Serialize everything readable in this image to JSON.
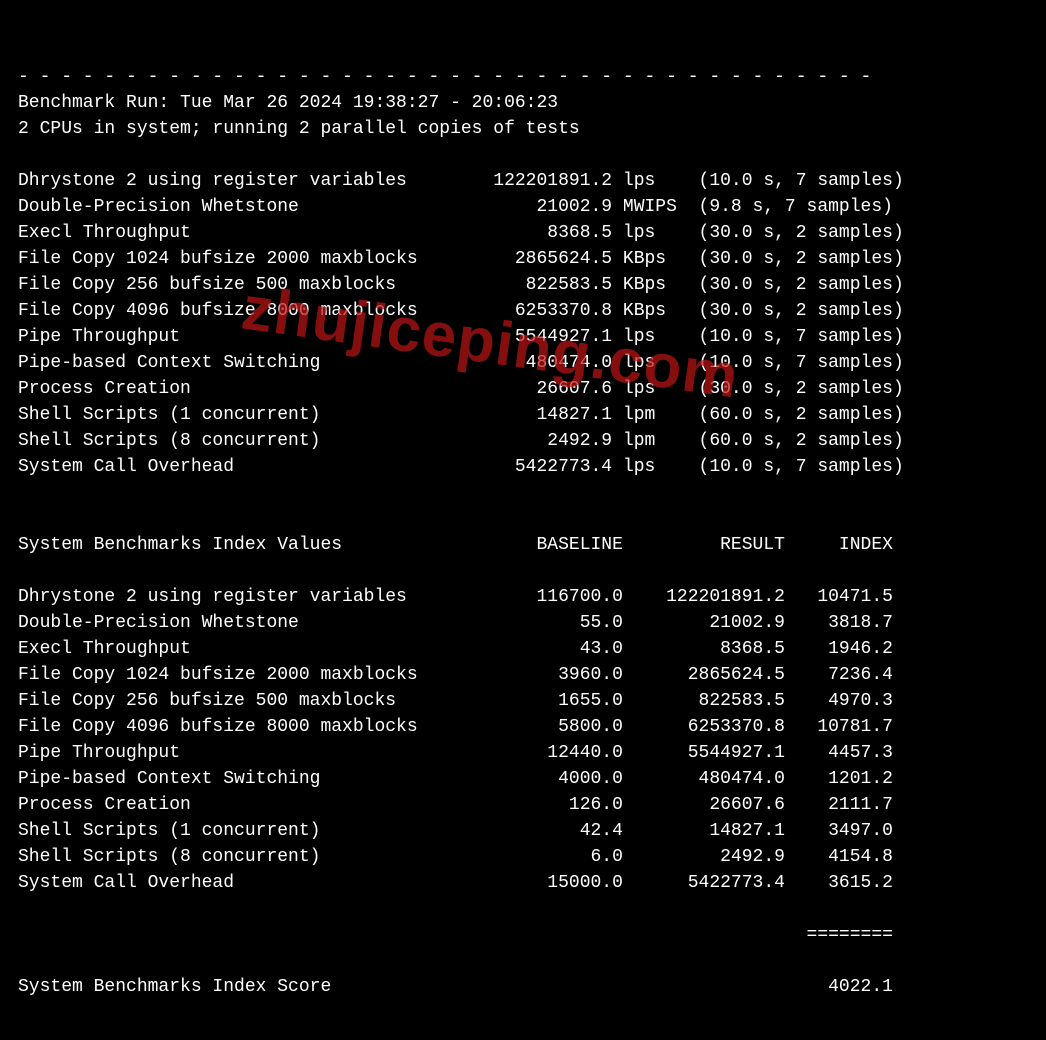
{
  "separator": "- - - - - - - - - - - - - - - - - - - - - - - - - - - - - - - - - - - - - - - -",
  "header": {
    "run_line": "Benchmark Run: Tue Mar 26 2024 19:38:27 - 20:06:23",
    "cpu_line": "2 CPUs in system; running 2 parallel copies of tests"
  },
  "results": [
    {
      "name": "Dhrystone 2 using register variables",
      "value": "122201891.2",
      "unit": "lps",
      "timing": "(10.0 s, 7 samples)"
    },
    {
      "name": "Double-Precision Whetstone",
      "value": "21002.9",
      "unit": "MWIPS",
      "timing": "(9.8 s, 7 samples)"
    },
    {
      "name": "Execl Throughput",
      "value": "8368.5",
      "unit": "lps",
      "timing": "(30.0 s, 2 samples)"
    },
    {
      "name": "File Copy 1024 bufsize 2000 maxblocks",
      "value": "2865624.5",
      "unit": "KBps",
      "timing": "(30.0 s, 2 samples)"
    },
    {
      "name": "File Copy 256 bufsize 500 maxblocks",
      "value": "822583.5",
      "unit": "KBps",
      "timing": "(30.0 s, 2 samples)"
    },
    {
      "name": "File Copy 4096 bufsize 8000 maxblocks",
      "value": "6253370.8",
      "unit": "KBps",
      "timing": "(30.0 s, 2 samples)"
    },
    {
      "name": "Pipe Throughput",
      "value": "5544927.1",
      "unit": "lps",
      "timing": "(10.0 s, 7 samples)"
    },
    {
      "name": "Pipe-based Context Switching",
      "value": "480474.0",
      "unit": "lps",
      "timing": "(10.0 s, 7 samples)"
    },
    {
      "name": "Process Creation",
      "value": "26607.6",
      "unit": "lps",
      "timing": "(30.0 s, 2 samples)"
    },
    {
      "name": "Shell Scripts (1 concurrent)",
      "value": "14827.1",
      "unit": "lpm",
      "timing": "(60.0 s, 2 samples)"
    },
    {
      "name": "Shell Scripts (8 concurrent)",
      "value": "2492.9",
      "unit": "lpm",
      "timing": "(60.0 s, 2 samples)"
    },
    {
      "name": "System Call Overhead",
      "value": "5422773.4",
      "unit": "lps",
      "timing": "(10.0 s, 7 samples)"
    }
  ],
  "index_header": {
    "title": "System Benchmarks Index Values",
    "col_baseline": "BASELINE",
    "col_result": "RESULT",
    "col_index": "INDEX"
  },
  "index_rows": [
    {
      "name": "Dhrystone 2 using register variables",
      "baseline": "116700.0",
      "result": "122201891.2",
      "index": "10471.5"
    },
    {
      "name": "Double-Precision Whetstone",
      "baseline": "55.0",
      "result": "21002.9",
      "index": "3818.7"
    },
    {
      "name": "Execl Throughput",
      "baseline": "43.0",
      "result": "8368.5",
      "index": "1946.2"
    },
    {
      "name": "File Copy 1024 bufsize 2000 maxblocks",
      "baseline": "3960.0",
      "result": "2865624.5",
      "index": "7236.4"
    },
    {
      "name": "File Copy 256 bufsize 500 maxblocks",
      "baseline": "1655.0",
      "result": "822583.5",
      "index": "4970.3"
    },
    {
      "name": "File Copy 4096 bufsize 8000 maxblocks",
      "baseline": "5800.0",
      "result": "6253370.8",
      "index": "10781.7"
    },
    {
      "name": "Pipe Throughput",
      "baseline": "12440.0",
      "result": "5544927.1",
      "index": "4457.3"
    },
    {
      "name": "Pipe-based Context Switching",
      "baseline": "4000.0",
      "result": "480474.0",
      "index": "1201.2"
    },
    {
      "name": "Process Creation",
      "baseline": "126.0",
      "result": "26607.6",
      "index": "2111.7"
    },
    {
      "name": "Shell Scripts (1 concurrent)",
      "baseline": "42.4",
      "result": "14827.1",
      "index": "3497.0"
    },
    {
      "name": "Shell Scripts (8 concurrent)",
      "baseline": "6.0",
      "result": "2492.9",
      "index": "4154.8"
    },
    {
      "name": "System Call Overhead",
      "baseline": "15000.0",
      "result": "5422773.4",
      "index": "3615.2"
    }
  ],
  "score": {
    "rule": "========",
    "label": "System Benchmarks Index Score",
    "value": "4022.1"
  },
  "watermark": "zhujiceping.com",
  "col": {
    "name_w": 41,
    "value_w": 14,
    "unit_w": 6,
    "idx_name_w": 41,
    "idx_baseline_w": 15,
    "idx_result_w": 15,
    "idx_index_w": 10,
    "score_value_w": 81
  }
}
